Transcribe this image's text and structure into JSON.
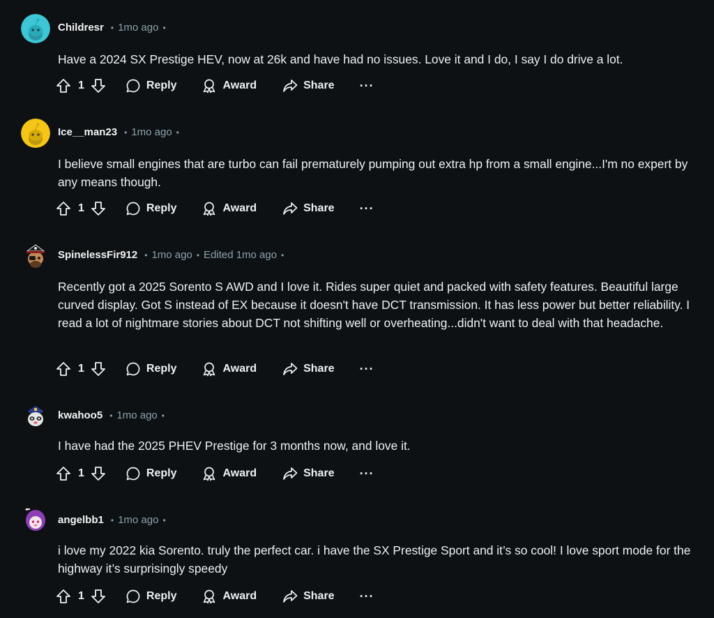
{
  "comments": [
    {
      "username": "Childresr",
      "time": "1mo ago",
      "edited": "",
      "text": "Have a 2024 SX Prestige HEV, now at 26k and have had no issues. Love it and I do, I say I do drive a lot.",
      "votes": "1",
      "avatar_icon": "snoo-avatar-teal",
      "avatar_bg": "#3dc7d6"
    },
    {
      "username": "Ice__man23",
      "time": "1mo ago",
      "edited": "",
      "text": "I believe small engines that are turbo can fail prematurely pumping out extra hp from a small engine...I'm no expert by any means though.",
      "votes": "1",
      "avatar_icon": "snoo-avatar-yellow",
      "avatar_bg": "#f5c518"
    },
    {
      "username": "SpinelessFir912",
      "time": "1mo ago",
      "edited": "Edited 1mo ago",
      "text": "Recently got a 2025 Sorento S AWD and I love it. Rides super quiet and packed with safety features. Beautiful large curved display. Got S instead of EX because it doesn't have DCT transmission. It has less power but better reliability. I read a lot of nightmare stories about DCT not shifting well or overheating...didn't want to deal with that headache.",
      "votes": "1",
      "avatar_icon": "custom-avatar-pirate",
      "avatar_bg": "#0e1113"
    },
    {
      "username": "kwahoo5",
      "time": "1mo ago",
      "edited": "",
      "text": "I have had the 2025 PHEV Prestige for 3 months now, and love it.",
      "votes": "1",
      "avatar_icon": "custom-avatar-police",
      "avatar_bg": "#0e1113"
    },
    {
      "username": "angelbb1",
      "time": "1mo ago",
      "edited": "",
      "text": "i love my 2022 kia Sorento. truly the perfect car. i have the SX Prestige Sport and it’s so cool! I love sport mode for the highway it’s surprisingly speedy",
      "votes": "1",
      "avatar_icon": "custom-avatar-purple-hair",
      "avatar_bg": "#0e1113"
    }
  ],
  "actions": {
    "reply": "Reply",
    "award": "Award",
    "share": "Share",
    "more": "···"
  },
  "icons": {
    "upvote": "upvote-arrow-icon",
    "downvote": "downvote-arrow-icon",
    "reply": "speech-bubble-icon",
    "award": "award-ribbon-icon",
    "share": "share-arrow-icon",
    "more": "more-ellipsis-icon"
  },
  "colors": {
    "background": "#0e1113",
    "text": "#eef1f3",
    "meta": "#8ba2ad"
  }
}
